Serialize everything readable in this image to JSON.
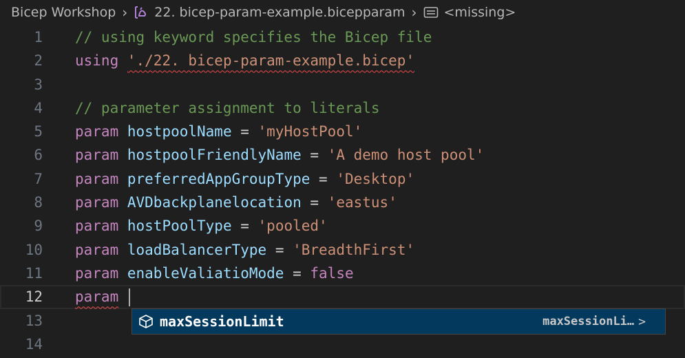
{
  "breadcrumb": {
    "workspace": "Bicep Workshop",
    "file": "22. bicep-param-example.bicepparam",
    "symbol": "<missing>"
  },
  "editor": {
    "current_line": 12,
    "lines": [
      {
        "number": "1",
        "tokens": [
          {
            "t": "// using keyword specifies the Bicep file",
            "k": "comment"
          }
        ]
      },
      {
        "number": "2",
        "tokens": [
          {
            "t": "using",
            "k": "keyword"
          },
          {
            "t": " ",
            "k": "op"
          },
          {
            "t": "'./22. bicep-param-example.bicep'",
            "k": "string",
            "err": true
          }
        ]
      },
      {
        "number": "3",
        "tokens": []
      },
      {
        "number": "4",
        "tokens": [
          {
            "t": "// parameter assignment to literals",
            "k": "comment"
          }
        ]
      },
      {
        "number": "5",
        "tokens": [
          {
            "t": "param",
            "k": "keyword"
          },
          {
            "t": " ",
            "k": "op"
          },
          {
            "t": "hostpoolName",
            "k": "ident"
          },
          {
            "t": " = ",
            "k": "op"
          },
          {
            "t": "'myHostPool'",
            "k": "string"
          }
        ]
      },
      {
        "number": "6",
        "tokens": [
          {
            "t": "param",
            "k": "keyword"
          },
          {
            "t": " ",
            "k": "op"
          },
          {
            "t": "hostpoolFriendlyName",
            "k": "ident"
          },
          {
            "t": " = ",
            "k": "op"
          },
          {
            "t": "'A demo host pool'",
            "k": "string"
          }
        ]
      },
      {
        "number": "7",
        "tokens": [
          {
            "t": "param",
            "k": "keyword"
          },
          {
            "t": " ",
            "k": "op"
          },
          {
            "t": "preferredAppGroupType",
            "k": "ident"
          },
          {
            "t": " = ",
            "k": "op"
          },
          {
            "t": "'Desktop'",
            "k": "string"
          }
        ]
      },
      {
        "number": "8",
        "tokens": [
          {
            "t": "param",
            "k": "keyword"
          },
          {
            "t": " ",
            "k": "op"
          },
          {
            "t": "AVDbackplanelocation",
            "k": "ident"
          },
          {
            "t": " = ",
            "k": "op"
          },
          {
            "t": "'eastus'",
            "k": "string"
          }
        ]
      },
      {
        "number": "9",
        "tokens": [
          {
            "t": "param",
            "k": "keyword"
          },
          {
            "t": " ",
            "k": "op"
          },
          {
            "t": "hostPoolType",
            "k": "ident"
          },
          {
            "t": " = ",
            "k": "op"
          },
          {
            "t": "'pooled'",
            "k": "string"
          }
        ]
      },
      {
        "number": "10",
        "tokens": [
          {
            "t": "param",
            "k": "keyword"
          },
          {
            "t": " ",
            "k": "op"
          },
          {
            "t": "loadBalancerType",
            "k": "ident"
          },
          {
            "t": " = ",
            "k": "op"
          },
          {
            "t": "'BreadthFirst'",
            "k": "string"
          }
        ]
      },
      {
        "number": "11",
        "tokens": [
          {
            "t": "param",
            "k": "keyword"
          },
          {
            "t": " ",
            "k": "op"
          },
          {
            "t": "enableValiatioMode",
            "k": "ident"
          },
          {
            "t": " = ",
            "k": "op"
          },
          {
            "t": "false",
            "k": "bool"
          }
        ]
      },
      {
        "number": "12",
        "tokens": [
          {
            "t": "param",
            "k": "keyword",
            "err": true
          },
          {
            "t": " ",
            "k": "op"
          }
        ],
        "cursor": true
      },
      {
        "number": "13",
        "tokens": []
      },
      {
        "number": "14",
        "tokens": []
      }
    ]
  },
  "suggestion": {
    "icon": "symbol-field-icon",
    "label": "maxSessionLimit",
    "detail": "maxSessionLi…",
    "more": ">"
  },
  "colors": {
    "background": "#1f1f1f",
    "keyword": "#c586c0",
    "string": "#ce9178",
    "identifier": "#9cdcfe",
    "comment": "#6a9955",
    "error": "#f14c4c",
    "suggest_selected": "#04395e"
  }
}
